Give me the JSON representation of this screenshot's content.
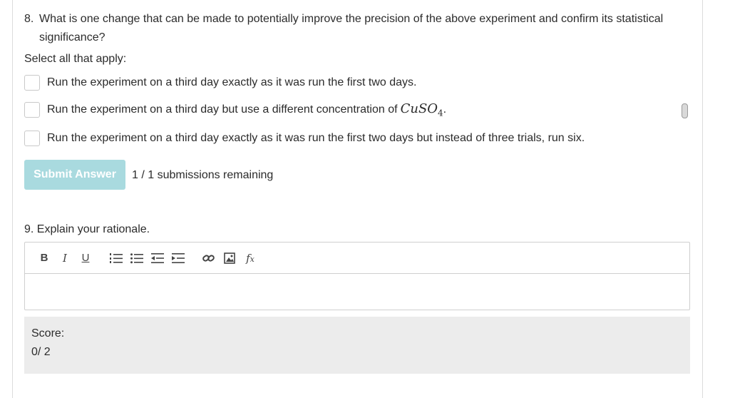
{
  "question8": {
    "number": "8.",
    "text_line1": "What is one change that can be made to potentially improve the precision of the above experiment and confirm its statistical",
    "text_line2": "significance?",
    "instruction": "Select all that apply:",
    "options": [
      {
        "label": "Run the experiment on a third day exactly as it was run the first two days."
      },
      {
        "label": "Run the experiment on a third day but use a different concentration of",
        "math": "CuSO",
        "math_sub": "4",
        "suffix": "."
      },
      {
        "label": "Run the experiment on a third day exactly as it was run the first two days but instead of three trials, run six."
      }
    ],
    "submit_label": "Submit Answer",
    "submissions_remaining": "1 / 1 submissions remaining"
  },
  "question9": {
    "text": "9. Explain your rationale.",
    "toolbar": {
      "bold": "B",
      "italic": "I",
      "underline": "U",
      "icons": [
        "numbered-list-icon",
        "bullet-list-icon",
        "outdent-icon",
        "indent-icon",
        "link-icon",
        "image-icon",
        "formula-icon"
      ]
    },
    "answer_value": ""
  },
  "score": {
    "label": "Score:",
    "value": "0/ 2"
  }
}
